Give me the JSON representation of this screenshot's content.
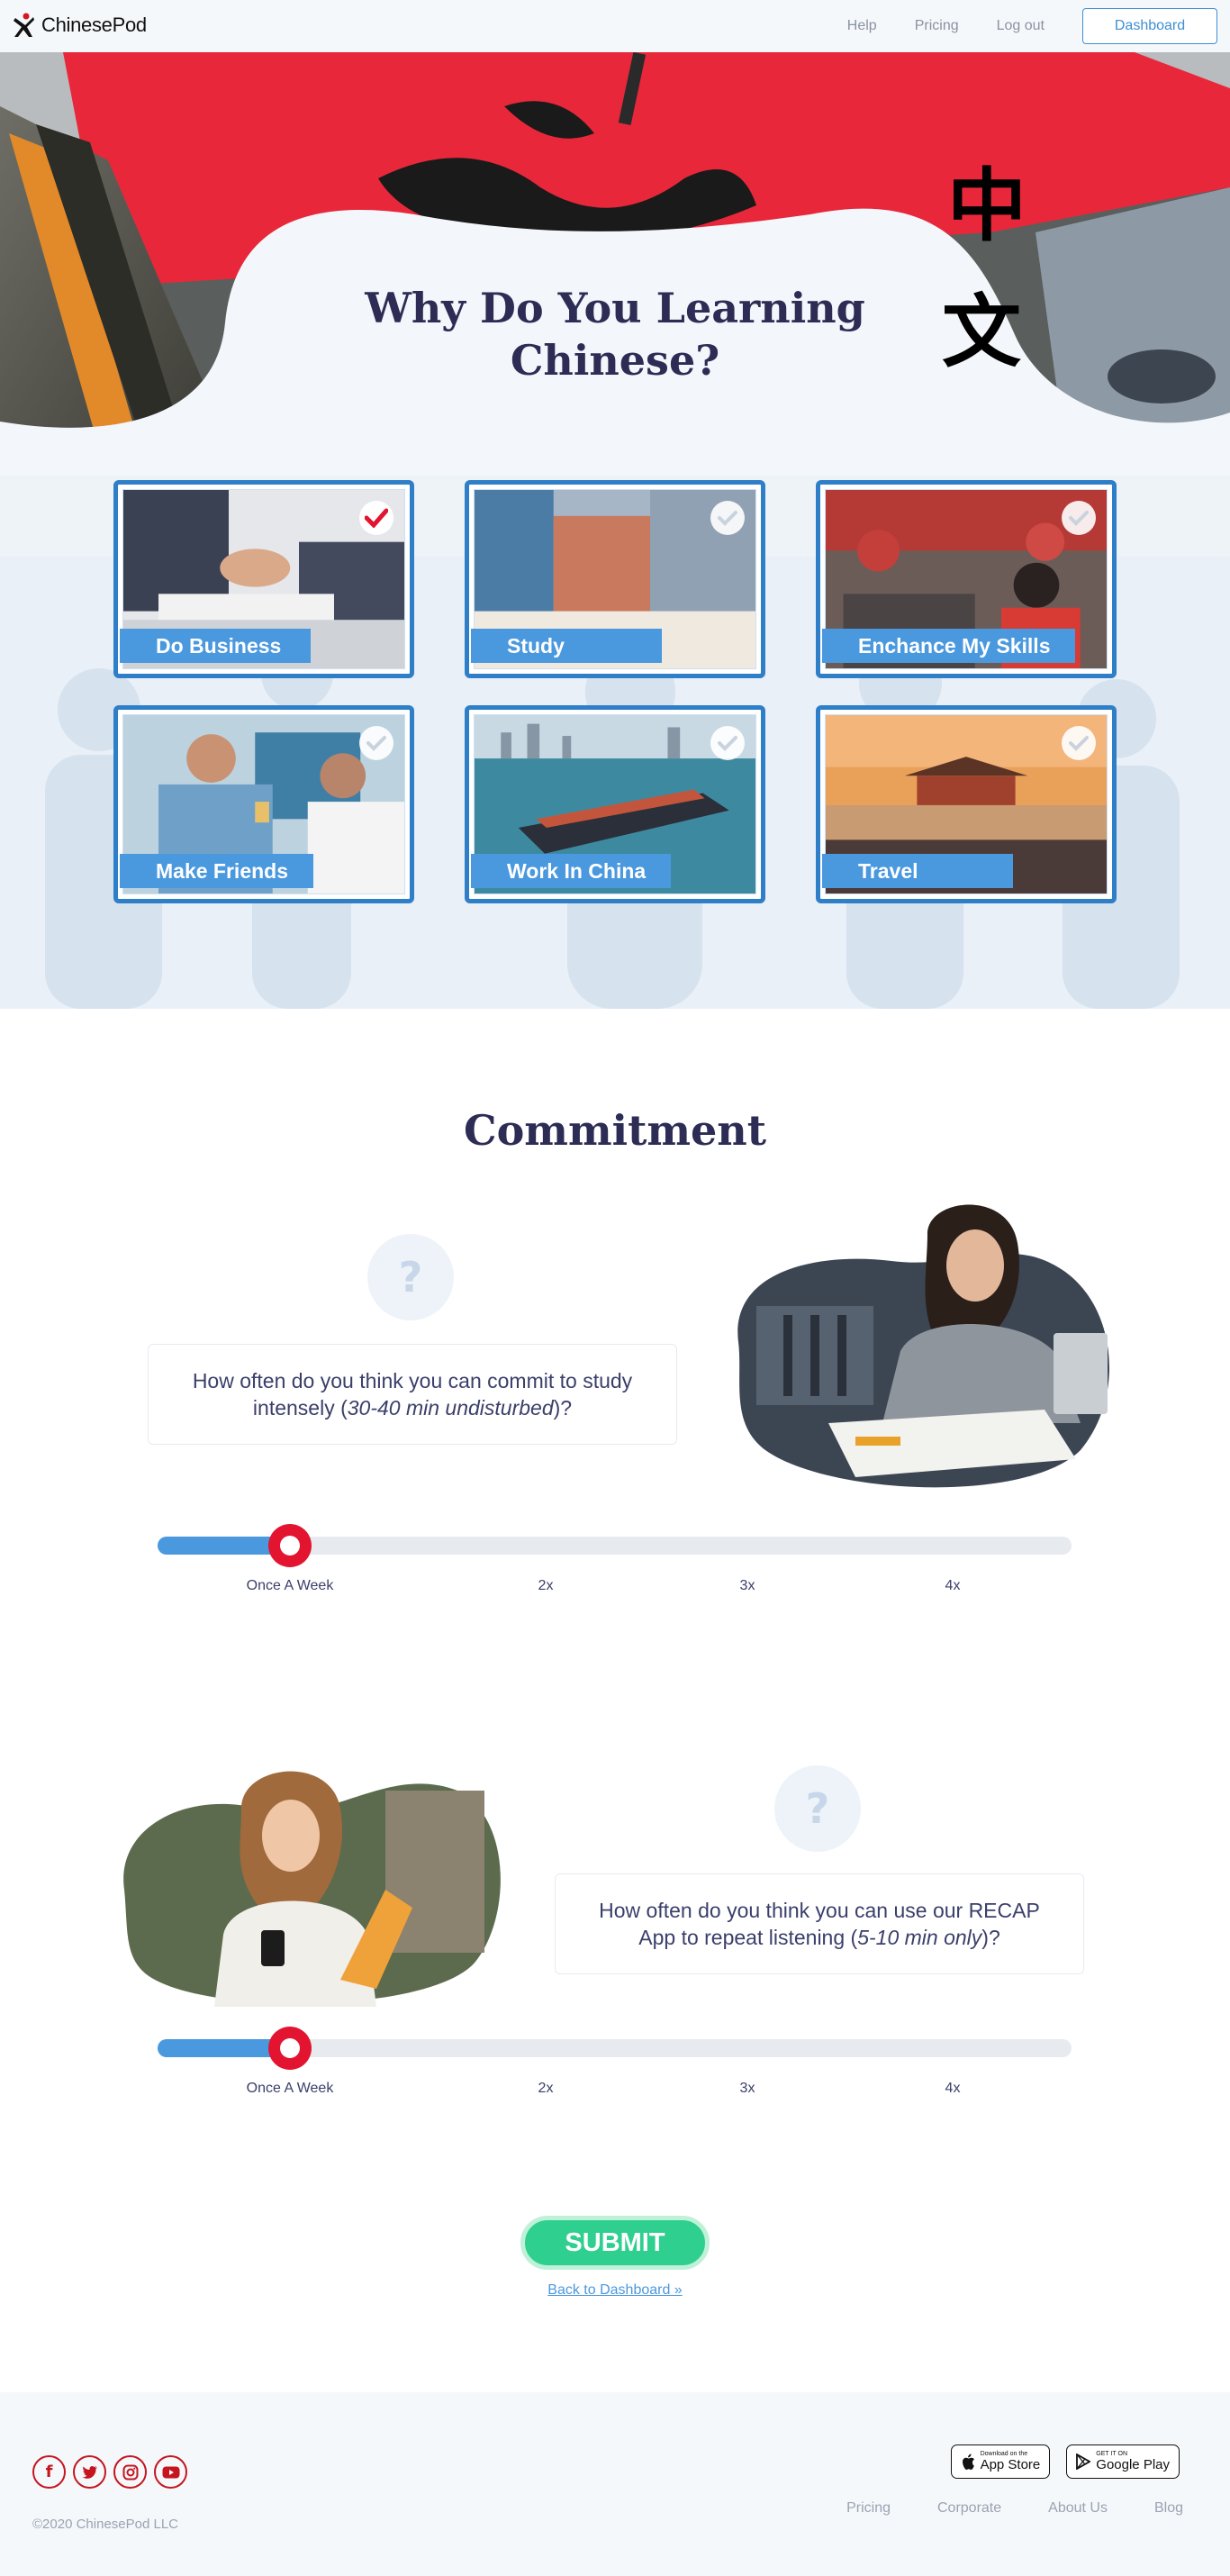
{
  "nav": {
    "brand": "ChinesePod",
    "links": [
      "Help",
      "Pricing",
      "Log out"
    ],
    "dashboard_label": "Dashboard"
  },
  "hero": {
    "title_line1": "Why Do You Learning",
    "title_line2": "Chinese?",
    "hanzi_1": "中",
    "hanzi_2": "文",
    "cards": [
      {
        "label": "Do Business",
        "selected": true
      },
      {
        "label": "Study",
        "selected": false
      },
      {
        "label": "Enchance My Skills",
        "selected": false
      },
      {
        "label": "Make Friends",
        "selected": false
      },
      {
        "label": "Work In China",
        "selected": false
      },
      {
        "label": "Travel",
        "selected": false
      }
    ]
  },
  "commitment": {
    "title": "Commitment",
    "question_mark": "?",
    "q1": {
      "before": "How often do you think you can commit to study intensely (",
      "italic": "30-40 min undisturbed",
      "after": ")?",
      "value": "Once A Week",
      "options": [
        "Once A Week",
        "2x",
        "3x",
        "4x"
      ],
      "level": 0.145
    },
    "q2": {
      "before": "How often do you think you can use our RECAP App  to repeat listening (",
      "italic": "5-10 min only",
      "after": ")?",
      "value": "Once A Week",
      "options": [
        "Once A Week",
        "2x",
        "3x",
        "4x"
      ],
      "level": 0.145
    }
  },
  "submit_label": "SUBMIT",
  "back_label": "Back to Dashboard »",
  "footer": {
    "copyright": "©2020 ChinesePod LLC",
    "social": [
      "facebook-icon",
      "twitter-icon",
      "instagram-icon",
      "youtube-icon"
    ],
    "appstore_small": "Download on the",
    "appstore_big": "App Store",
    "googleplay_small": "GET IT ON",
    "googleplay_big": "Google Play",
    "links": [
      "Pricing",
      "Corporate",
      "About Us",
      "Blog"
    ]
  },
  "colors": {
    "accent": "#4a98de",
    "card_border": "#2f7fc8",
    "thumb": "#e3142f",
    "submit": "#2ecf8f",
    "heading": "#2c2c54"
  }
}
